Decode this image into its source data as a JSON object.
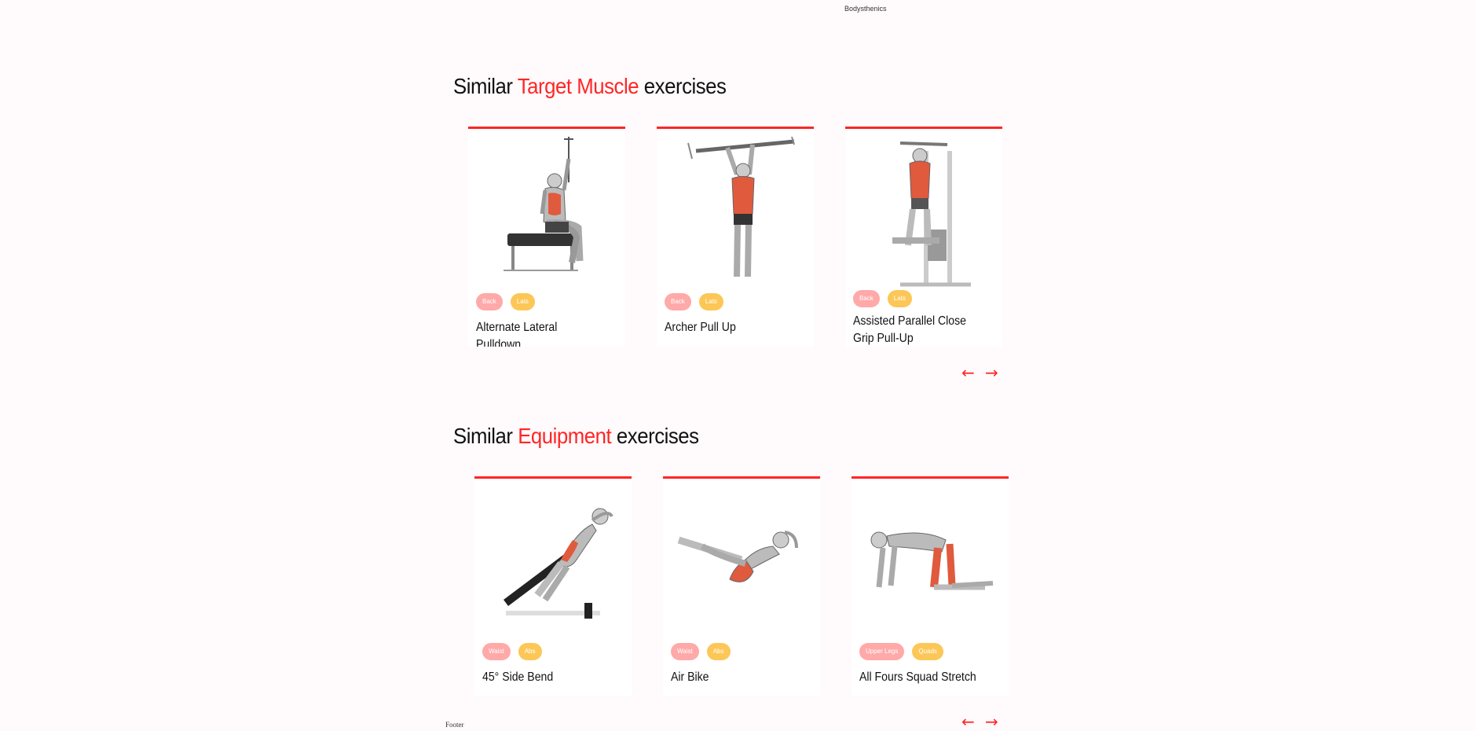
{
  "header": {
    "equipment_label": "Bodysthenics"
  },
  "target_section": {
    "title_prefix": "Similar ",
    "title_accent": "Target Muscle",
    "title_suffix": " exercises",
    "cards": [
      {
        "name": "Alternate Lateral Pulldown",
        "tags": [
          "Back",
          "Lats"
        ],
        "illustration": "lat-pulldown-figure"
      },
      {
        "name": "Archer Pull Up",
        "tags": [
          "Back",
          "Lats"
        ],
        "illustration": "pull-up-figure"
      },
      {
        "name": "Assisted Parallel Close Grip Pull-Up",
        "tags": [
          "Back",
          "Lats"
        ],
        "illustration": "assisted-pullup-machine-figure"
      }
    ],
    "prev_arrow": "←",
    "next_arrow": "→"
  },
  "equipment_section": {
    "title_prefix": "Similar ",
    "title_accent": "Equipment",
    "title_suffix": " exercises",
    "cards": [
      {
        "name": "45° Side Bend",
        "tags": [
          "Waist",
          "Abs"
        ],
        "illustration": "side-bend-bench-figure"
      },
      {
        "name": "Air Bike",
        "tags": [
          "Waist",
          "Abs"
        ],
        "illustration": "air-bike-figure"
      },
      {
        "name": "All Fours Squad Stretch",
        "tags": [
          "Upper Legs",
          "Quads"
        ],
        "illustration": "all-fours-stretch-figure"
      }
    ],
    "prev_arrow": "←",
    "next_arrow": "→"
  },
  "footer": {
    "label": "Footer"
  },
  "colors": {
    "accent": "#ff2625",
    "tag_pink": "#ffa9a9",
    "tag_yellow": "#fcc757",
    "background": "#fffafb"
  }
}
